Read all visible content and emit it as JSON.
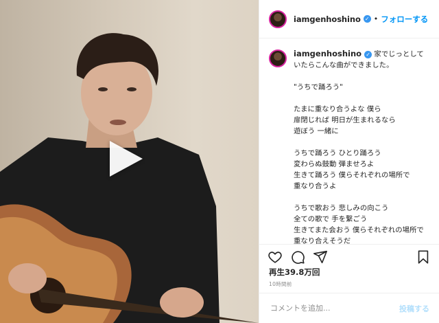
{
  "header": {
    "username": "iamgenhoshino",
    "verified_icon": "verified-badge-icon",
    "follow_label": "フォローする"
  },
  "caption": {
    "username": "iamgenhoshino",
    "text": " 家でじっとしていたらこんな曲ができました。\n\n\"うちで踊ろう\"\n\nたまに重なり合うよな 僕ら\n扉閉じれば 明日が生まれるなら\n遊ぼう 一緒に\n\nうちで踊ろう ひとり踊ろう\n変わらぬ鼓動 弾ませろよ\n生きて踊ろう 僕らそれぞれの場所で\n重なり合うよ\n\nうちで歌おう 悲しみの向こう\n全ての歌で 手を繋ごう\n生きてまた会おう 僕らそれぞれの場所で\n重なり合えそうだ"
  },
  "actions": {
    "like_icon": "heart-icon",
    "comment_icon": "comment-icon",
    "share_icon": "share-icon",
    "save_icon": "bookmark-icon"
  },
  "stats": {
    "views": "再生39.8万回",
    "time": "10時間前"
  },
  "comment_box": {
    "placeholder": "コメントを追加...",
    "post_label": "投稿する"
  },
  "media": {
    "play_icon": "play-icon"
  }
}
